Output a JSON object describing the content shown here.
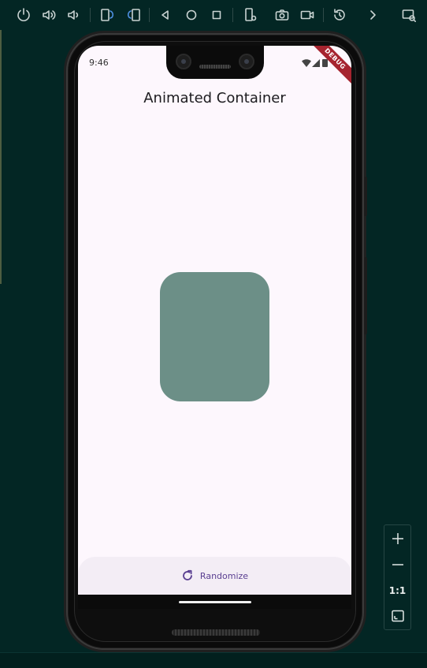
{
  "toolbar": {
    "buttons": [
      {
        "icon": "power-icon"
      },
      {
        "icon": "volume-up-icon"
      },
      {
        "icon": "volume-down-icon"
      },
      {
        "icon": "rotate-left-icon"
      },
      {
        "icon": "rotate-right-icon"
      },
      {
        "icon": "back-icon"
      },
      {
        "icon": "home-icon"
      },
      {
        "icon": "overview-icon"
      },
      {
        "icon": "device-settings-icon"
      },
      {
        "icon": "screenshot-icon"
      },
      {
        "icon": "screen-record-icon"
      },
      {
        "icon": "snapshot-restore-icon"
      },
      {
        "icon": "more-chevron-icon"
      },
      {
        "icon": "device-mirror-icon"
      }
    ]
  },
  "device": {
    "status_time": "9:46",
    "debug_banner": "DEBUG"
  },
  "app": {
    "title": "Animated Container",
    "box_color": "#6c8f87",
    "randomize_label": "Randomize",
    "randomize_icon": "refresh-icon",
    "accent_color": "#5a3f91"
  },
  "zoom": {
    "zoom_in_icon": "plus-icon",
    "zoom_out_icon": "minus-icon",
    "actual_size_label": "1:1",
    "fit_screen_icon": "fit-screen-icon"
  }
}
